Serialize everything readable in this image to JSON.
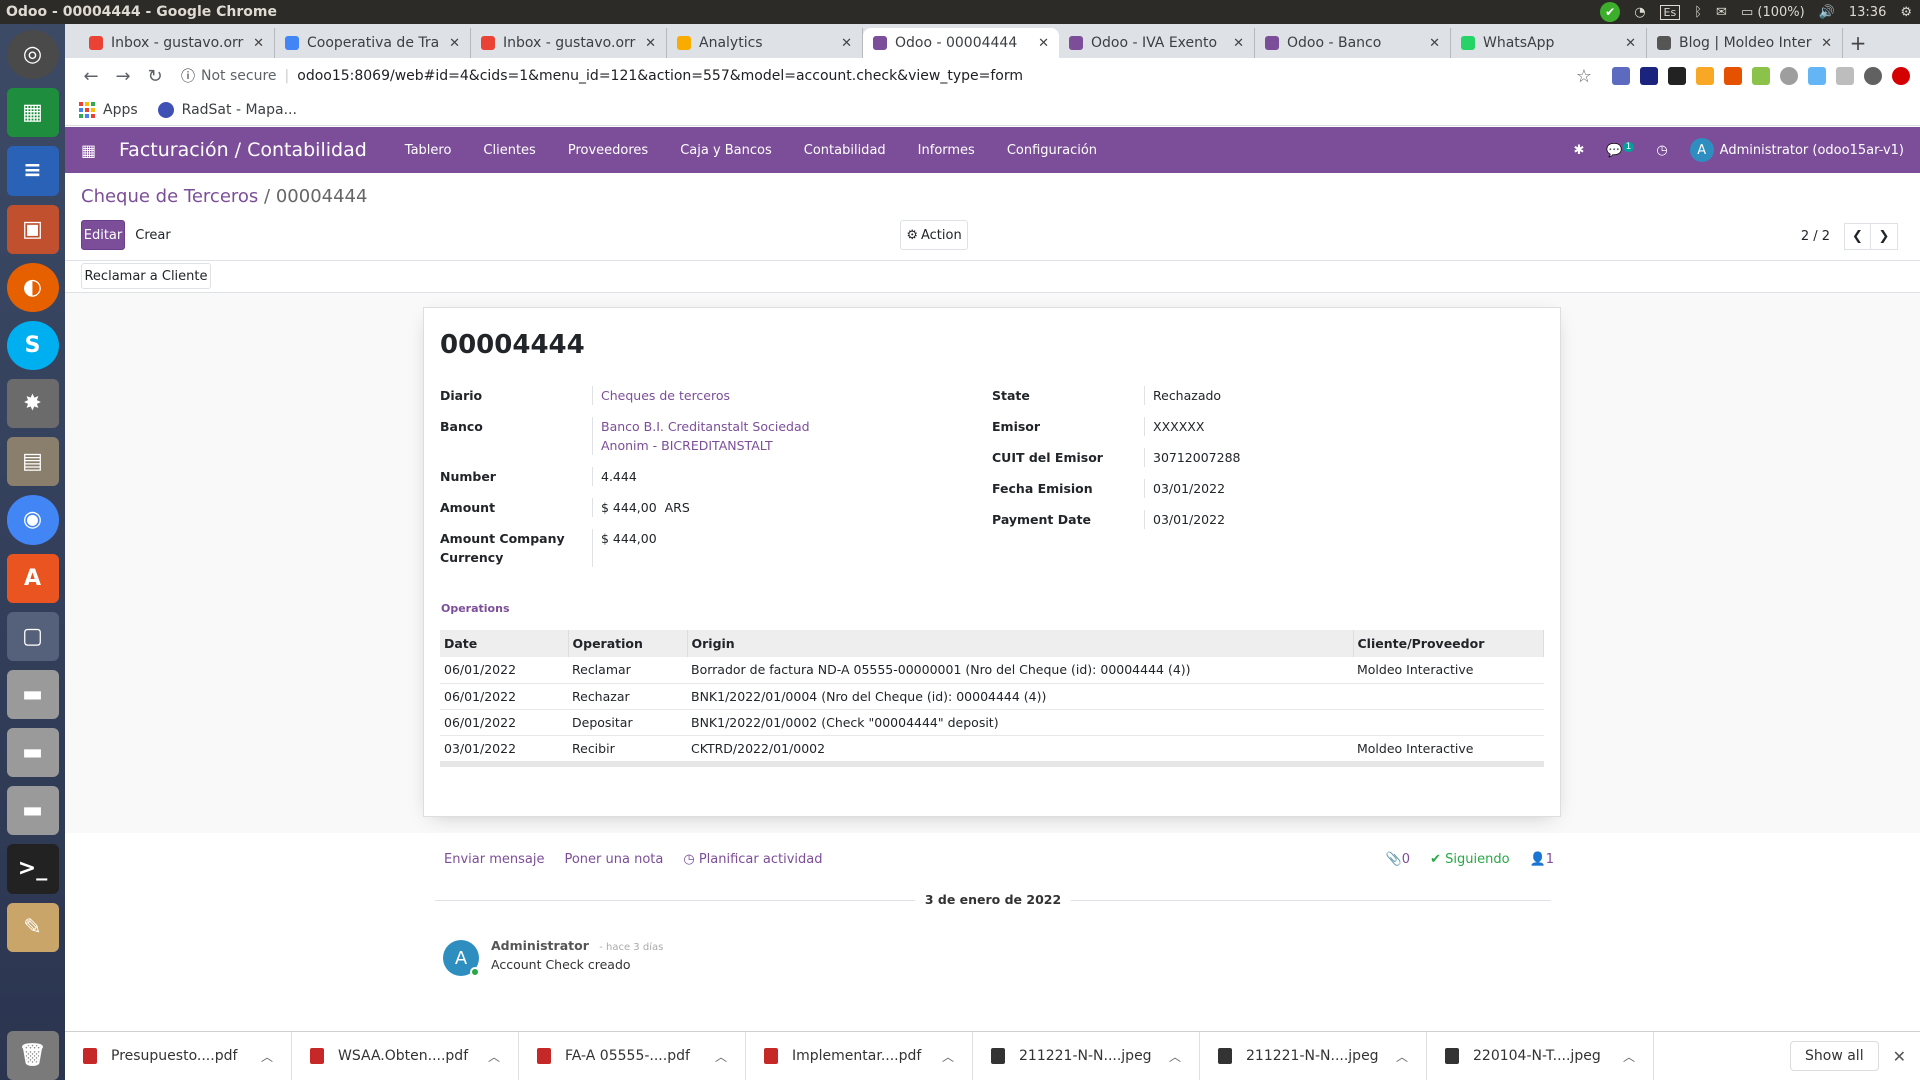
{
  "window": {
    "title": "Odoo - 00004444 - Google Chrome",
    "clock": "13:36",
    "battery": "(100%)",
    "keyboard": "Es"
  },
  "tabs": [
    {
      "label": "Inbox - gustavo.orr",
      "color": "#ea4335",
      "active": false
    },
    {
      "label": "Cooperativa de Tra",
      "color": "#4285f4",
      "active": false
    },
    {
      "label": "Inbox - gustavo.orr",
      "color": "#ea4335",
      "active": false
    },
    {
      "label": "Analytics",
      "color": "#f9ab00",
      "active": false
    },
    {
      "label": "Odoo - 00004444",
      "color": "#7c4e99",
      "active": true
    },
    {
      "label": "Odoo - IVA Exento",
      "color": "#7c4e99",
      "active": false
    },
    {
      "label": "Odoo - Banco",
      "color": "#7c4e99",
      "active": false
    },
    {
      "label": "WhatsApp",
      "color": "#25d366",
      "active": false
    },
    {
      "label": "Blog | Moldeo Inter",
      "color": "#555555",
      "active": false
    }
  ],
  "address": {
    "security": "Not secure",
    "url": "odoo15:8069/web#id=4&cids=1&menu_id=121&action=557&model=account.check&view_type=form"
  },
  "bookmarks": {
    "apps": "Apps",
    "radsat": "RadSat - Mapa..."
  },
  "odoo": {
    "app_name": "Facturación / Contabilidad",
    "menu": [
      "Tablero",
      "Clientes",
      "Proveedores",
      "Caja y Bancos",
      "Contabilidad",
      "Informes",
      "Configuración"
    ],
    "messages_badge": "1",
    "user": "Administrator (odoo15ar-v1)",
    "user_initial": "A"
  },
  "control": {
    "breadcrumb_parent": "Cheque de Terceros",
    "breadcrumb_sep": "/",
    "breadcrumb_current": "00004444",
    "edit_label": "Editar",
    "create_label": "Crear",
    "action_label": "Action",
    "pager": "2 / 2",
    "claim_label": "Reclamar a Cliente"
  },
  "record": {
    "title": "00004444",
    "left_fields": [
      {
        "label": "Diario",
        "value": "Cheques de terceros",
        "link": true
      },
      {
        "label": "Banco",
        "value": "Banco B.I. Creditanstalt Sociedad Anonim - BICREDITANSTALT",
        "link": true
      },
      {
        "label": "Number",
        "value": "4.444",
        "link": false
      },
      {
        "label": "Amount",
        "value": "$ 444,00  ARS",
        "link": false
      },
      {
        "label": "Amount Company Currency",
        "value": "$ 444,00",
        "link": false
      }
    ],
    "right_fields": [
      {
        "label": "State",
        "value": "Rechazado"
      },
      {
        "label": "Emisor",
        "value": "XXXXXX"
      },
      {
        "label": "CUIT del Emisor",
        "value": "30712007288"
      },
      {
        "label": "Fecha Emision",
        "value": "03/01/2022"
      },
      {
        "label": "Payment Date",
        "value": "03/01/2022"
      }
    ]
  },
  "operations": {
    "title": "Operations",
    "columns": [
      "Date",
      "Operation",
      "Origin",
      "Cliente/Proveedor"
    ],
    "rows": [
      [
        "06/01/2022",
        "Reclamar",
        "Borrador de factura ND-A 05555-00000001 (Nro del Cheque (id): 00004444 (4))",
        "Moldeo Interactive"
      ],
      [
        "06/01/2022",
        "Rechazar",
        "BNK1/2022/01/0004 (Nro del Cheque (id): 00004444 (4))",
        ""
      ],
      [
        "06/01/2022",
        "Depositar",
        "BNK1/2022/01/0002 (Check \"00004444\" deposit)",
        ""
      ],
      [
        "03/01/2022",
        "Recibir",
        "CKTRD/2022/01/0002",
        "Moldeo Interactive"
      ]
    ]
  },
  "chatter": {
    "send_message": "Enviar mensaje",
    "log_note": "Poner una nota",
    "schedule": "Planificar actividad",
    "attachments": "0",
    "following": "Siguiendo",
    "followers": "1",
    "date_separator": "3 de enero de 2022",
    "author": "Administrator",
    "author_initial": "A",
    "time": "- hace 3 días",
    "body": "Account Check creado"
  },
  "downloads": {
    "items": [
      "Presupuesto....pdf",
      "WSAA.Obten....pdf",
      "FA-A 05555-....pdf",
      "Implementar....pdf",
      "211221-N-N....jpeg",
      "211221-N-N....jpeg",
      "220104-N-T....jpeg"
    ],
    "show_all": "Show all"
  }
}
